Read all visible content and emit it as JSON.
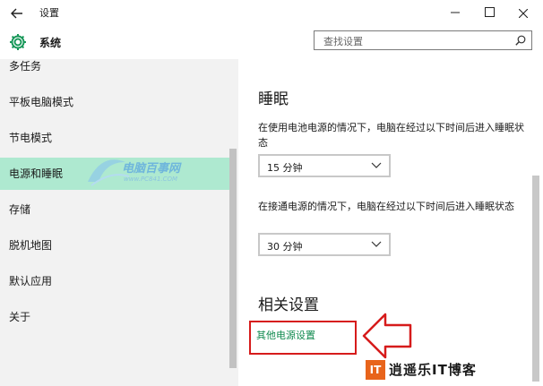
{
  "window": {
    "back_icon": "back-arrow-icon",
    "title": "设置",
    "controls": [
      "minimize-icon",
      "maximize-icon",
      "close-icon"
    ]
  },
  "header": {
    "icon": "gear-icon",
    "title": "系统",
    "search": {
      "placeholder": "查找设置",
      "icon": "search-icon"
    }
  },
  "sidebar": {
    "items": [
      {
        "label": "多任务",
        "selected": false
      },
      {
        "label": "平板电脑模式",
        "selected": false
      },
      {
        "label": "节电模式",
        "selected": false
      },
      {
        "label": "电源和睡眠",
        "selected": true
      },
      {
        "label": "存储",
        "selected": false
      },
      {
        "label": "脱机地图",
        "selected": false
      },
      {
        "label": "默认应用",
        "selected": false
      },
      {
        "label": "关于",
        "selected": false
      }
    ],
    "watermark": {
      "title": "电脑百事网",
      "url": "www.PC841.COM"
    }
  },
  "main": {
    "sleep_heading": "睡眠",
    "battery_desc": "在使用电池电源的情况下，电脑在经过以下时间后进入睡眠状态",
    "battery_value": "15 分钟",
    "plugged_desc": "在接通电源的情况下，电脑在经过以下时间后进入睡眠状态",
    "plugged_value": "30 分钟",
    "related_heading": "相关设置",
    "other_power_link": "其他电源设置"
  },
  "annotation": {
    "box_color": "#d61b1b",
    "accent_color": "#118a4f",
    "selection_color": "#aee9d0"
  },
  "logo": {
    "mark": "IT",
    "text": "逍遥乐IT博客"
  }
}
